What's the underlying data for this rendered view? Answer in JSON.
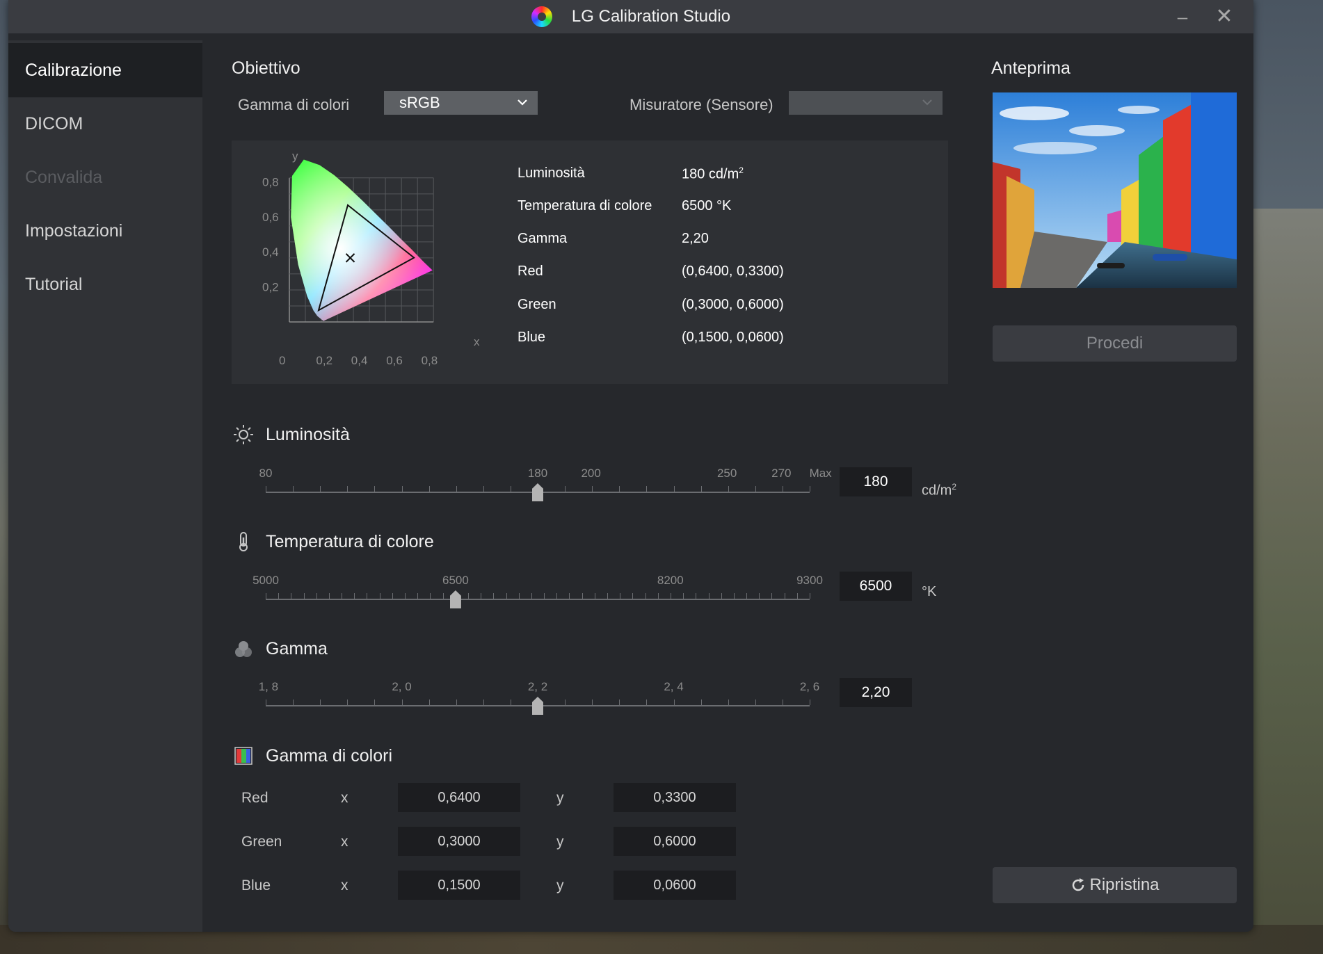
{
  "window": {
    "title": "LG Calibration Studio",
    "minimize_glyph": "–",
    "close_glyph": "✕"
  },
  "sidebar": {
    "items": [
      {
        "label": "Calibrazione",
        "state": "active"
      },
      {
        "label": "DICOM",
        "state": "normal"
      },
      {
        "label": "Convalida",
        "state": "disabled"
      },
      {
        "label": "Impostazioni",
        "state": "normal"
      },
      {
        "label": "Tutorial",
        "state": "normal"
      }
    ]
  },
  "target": {
    "heading": "Obiettivo",
    "gamut_label": "Gamma di colori",
    "gamut_value": "sRGB",
    "sensor_label": "Misuratore (Sensore)",
    "sensor_value": ""
  },
  "chromaticity": {
    "y_axis": "y",
    "x_axis": "x",
    "y_ticks": [
      "0,8",
      "0,6",
      "0,4",
      "0,2"
    ],
    "x_ticks": [
      "0",
      "0,2",
      "0,4",
      "0,6",
      "0,8"
    ],
    "triangle": {
      "red": [
        0.64,
        0.33
      ],
      "green": [
        0.3,
        0.6
      ],
      "blue": [
        0.15,
        0.06
      ]
    },
    "white_point": [
      0.3127,
      0.329
    ]
  },
  "summary": [
    {
      "key": "Luminosità",
      "value": "180 cd/m",
      "sup": "2"
    },
    {
      "key": "Temperatura di colore",
      "value": "6500 °K",
      "sup": ""
    },
    {
      "key": "Gamma",
      "value": "2,20",
      "sup": ""
    },
    {
      "key": "Red",
      "value": "(0,6400, 0,3300)",
      "sup": ""
    },
    {
      "key": "Green",
      "value": "(0,3000, 0,6000)",
      "sup": ""
    },
    {
      "key": "Blue",
      "value": "(0,1500, 0,0600)",
      "sup": ""
    }
  ],
  "luminance": {
    "title": "Luminosità",
    "ticks": [
      "80",
      "180",
      "200",
      "250",
      "270",
      "Max"
    ],
    "value": "180",
    "unit": "cd/m",
    "unit_sup": "2",
    "fraction": 0.5
  },
  "color_temp": {
    "title": "Temperatura di colore",
    "ticks": [
      "5000",
      "6500",
      "8200",
      "9300"
    ],
    "value": "6500",
    "unit": "°K",
    "fraction": 0.349
  },
  "gamma": {
    "title": "Gamma",
    "ticks": [
      "1, 8",
      "2, 0",
      "2, 2",
      "2, 4",
      "2, 6"
    ],
    "value": "2,20",
    "fraction": 0.5
  },
  "gamut": {
    "title": "Gamma di colori",
    "x_label": "x",
    "y_label": "y",
    "rows": [
      {
        "name": "Red",
        "x": "0,6400",
        "y": "0,3300"
      },
      {
        "name": "Green",
        "x": "0,3000",
        "y": "0,6000"
      },
      {
        "name": "Blue",
        "x": "0,1500",
        "y": "0,0600"
      }
    ]
  },
  "preview": {
    "heading": "Anteprima",
    "proceed_label": "Procedi",
    "reset_label": "Ripristina"
  },
  "colors": {
    "accent_active": "#1e2023",
    "panel": "#26282c",
    "sidebar": "#303236"
  }
}
